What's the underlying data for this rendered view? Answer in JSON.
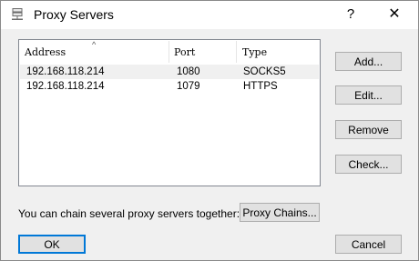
{
  "window": {
    "title": "Proxy Servers",
    "help_glyph": "?",
    "close_glyph": "✕"
  },
  "list": {
    "columns": [
      "Address",
      "Port",
      "Type"
    ],
    "rows": [
      {
        "address": "192.168.118.214",
        "port": "1080",
        "type": "SOCKS5",
        "selected": true
      },
      {
        "address": "192.168.118.214",
        "port": "1079",
        "type": "HTTPS",
        "selected": false
      }
    ]
  },
  "side_buttons": {
    "add": "Add...",
    "edit": "Edit...",
    "remove": "Remove",
    "check": "Check..."
  },
  "chain": {
    "text": "You can chain several proxy servers together:",
    "button": "Proxy Chains..."
  },
  "footer": {
    "ok": "OK",
    "cancel": "Cancel"
  },
  "colors": {
    "accent": "#0078d7",
    "window_bg": "#f0f0f0",
    "button_bg": "#e1e1e1"
  }
}
